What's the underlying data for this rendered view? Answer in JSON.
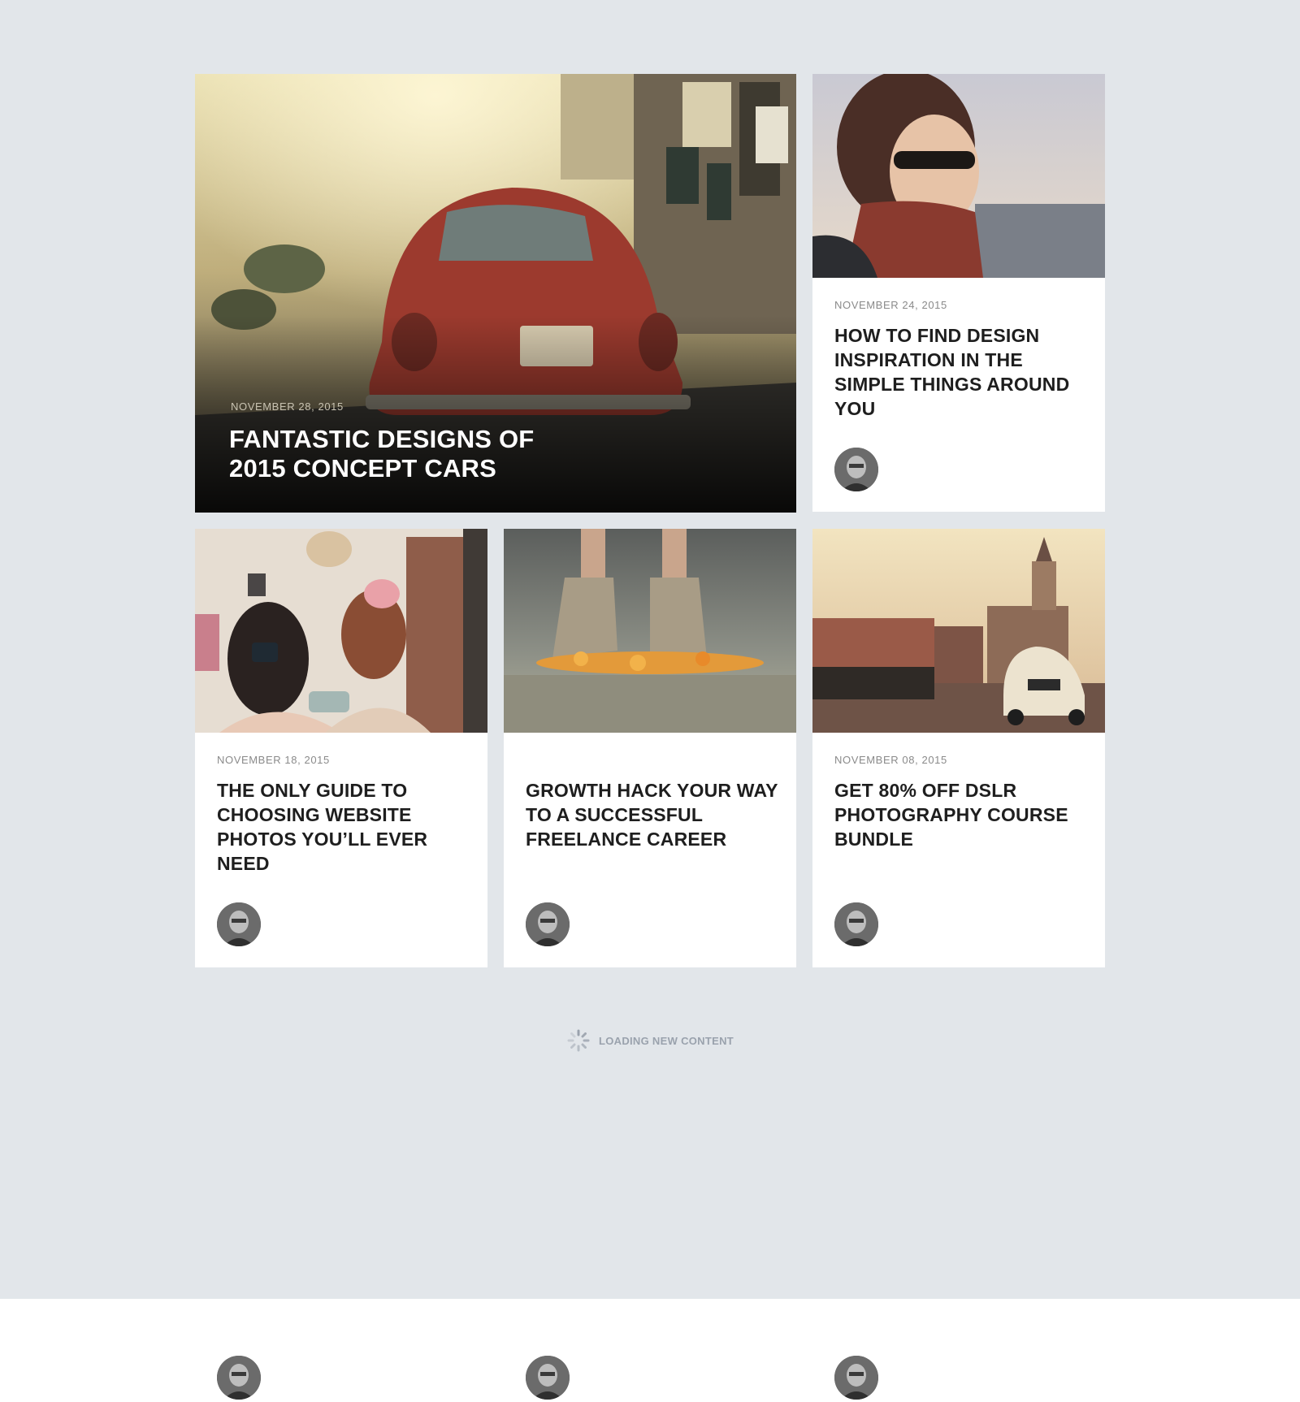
{
  "posts": [
    {
      "id": "featured",
      "date": "NOVEMBER 28, 2015",
      "title": "FANTASTIC DESIGNS OF 2015 CONCEPT CARS",
      "image": "red-beetle-car-street-photo"
    },
    {
      "id": "inspiration",
      "date": "NOVEMBER 24, 2015",
      "title": "HOW TO FIND DESIGN INSPIRATION IN THE SIMPLE THINGS AROUND YOU",
      "image": "woman-sunglasses-scarf-photo",
      "author_avatar": "author-avatar"
    },
    {
      "id": "photos",
      "date": "NOVEMBER 18, 2015",
      "title": "THE ONLY GUIDE TO CHOOSING WEBSITE PHOTOS YOU’LL EVER NEED",
      "image": "girls-with-camera-photo",
      "author_avatar": "author-avatar"
    },
    {
      "id": "growth",
      "date": "",
      "title": "GROWTH HACK YOUR WAY TO A SUCCESSFUL FREELANCE CAREER",
      "image": "boots-and-flowers-photo",
      "author_avatar": "author-avatar"
    },
    {
      "id": "dslr",
      "date": "NOVEMBER 08, 2015",
      "title": "GET 80% OFF DSLR PHOTOGRAPHY COURSE BUNDLE",
      "image": "town-square-vintage-car-photo",
      "author_avatar": "author-avatar"
    }
  ],
  "loading": {
    "label": "LOADING NEW CONTENT",
    "icon": "spinner-icon"
  },
  "colors": {
    "background": "#e2e6ea",
    "card": "#ffffff",
    "title": "#1e1e1e",
    "date": "#8a8a8a",
    "loading_text": "#9aa2ad"
  }
}
